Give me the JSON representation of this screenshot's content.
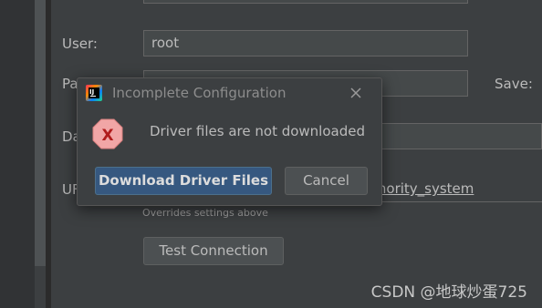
{
  "form": {
    "user_label": "User:",
    "user_value": "root",
    "password_label": "Pa",
    "save_label": "Save:",
    "database_label": "Da",
    "url_label": "UF",
    "url_value_visible": "thority_system",
    "hint": "Overrides settings above",
    "test_connection_label": "Test Connection"
  },
  "dialog": {
    "title": "Incomplete Configuration",
    "logo_text": "IJ",
    "message": "Driver files are not downloaded",
    "error_icon_glyph": "X",
    "primary_button": "Download Driver Files",
    "cancel_button": "Cancel"
  },
  "watermark": "CSDN @地球炒蛋725",
  "colors": {
    "background": "#3c3f41",
    "primary_button": "#365880",
    "error_icon": "#f1a6a6"
  },
  "icons": {
    "logo": "intellij-logo-icon",
    "close": "close-icon",
    "error": "error-icon"
  }
}
